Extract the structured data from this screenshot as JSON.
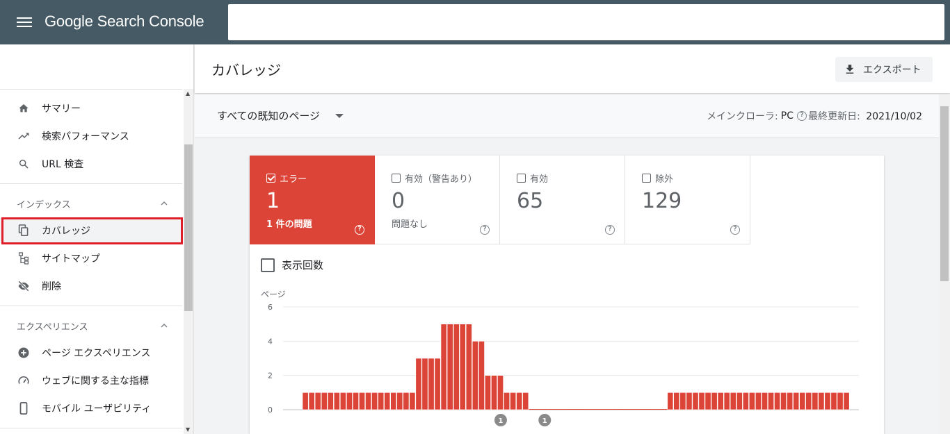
{
  "app": {
    "brand": "Google Search Console",
    "search_value": ""
  },
  "sidebar": {
    "items_top": [
      {
        "label": "サマリー",
        "icon": "home-icon"
      },
      {
        "label": "検索パフォーマンス",
        "icon": "trending-up-icon"
      },
      {
        "label": "URL 検査",
        "icon": "search-icon"
      }
    ],
    "index_section": "インデックス",
    "index_items": [
      {
        "label": "カバレッジ",
        "icon": "file-copy-icon"
      },
      {
        "label": "サイトマップ",
        "icon": "sitemap-icon"
      },
      {
        "label": "削除",
        "icon": "visibility-off-icon"
      }
    ],
    "experience_section": "エクスペリエンス",
    "experience_items": [
      {
        "label": "ページ エクスペリエンス",
        "icon": "add-circle-icon"
      },
      {
        "label": "ウェブに関する主な指標",
        "icon": "speed-icon"
      },
      {
        "label": "モバイル ユーザビリティ",
        "icon": "smartphone-icon"
      }
    ]
  },
  "header": {
    "title": "カバレッジ",
    "export_label": "エクスポート"
  },
  "filter": {
    "selected": "すべての既知のページ",
    "crawler_label": "メインクローラ:",
    "crawler_value": "PC",
    "updated_label": "最終更新日:",
    "updated_value": "2021/10/02"
  },
  "tiles": [
    {
      "label": "エラー",
      "value": "1",
      "sub": "1 件の問題",
      "checked": true
    },
    {
      "label": "有効（警告あり）",
      "value": "0",
      "sub": "問題なし",
      "checked": false
    },
    {
      "label": "有効",
      "value": "65",
      "sub": "",
      "checked": false
    },
    {
      "label": "除外",
      "value": "129",
      "sub": "",
      "checked": false
    }
  ],
  "impressions_label": "表示回数",
  "colors": {
    "topbar": "#455a64",
    "error": "#db4437",
    "highlight": "#e01e28"
  },
  "chart_data": {
    "type": "bar",
    "ylabel": "ページ",
    "ylim": [
      0,
      6
    ],
    "yticks": [
      0,
      2,
      4,
      6
    ],
    "grid": true,
    "values": [
      1,
      1,
      1,
      1,
      1,
      1,
      1,
      1,
      1,
      1,
      1,
      1,
      1,
      1,
      1,
      1,
      1,
      1,
      3,
      3,
      3,
      3,
      5,
      5,
      5,
      5,
      5,
      4,
      4,
      2,
      2,
      2,
      1,
      1,
      1,
      1,
      0,
      0,
      0,
      0,
      0,
      0,
      0,
      0,
      0,
      0,
      0,
      0,
      0,
      0,
      0,
      0,
      0,
      0,
      0,
      0,
      0,
      0,
      1,
      1,
      1,
      1,
      1,
      1,
      1,
      1,
      1,
      1,
      1,
      1,
      1,
      1,
      1,
      1,
      1,
      1,
      1,
      1,
      1,
      1,
      1,
      1,
      1,
      1,
      1,
      1,
      1
    ],
    "annotations": [
      {
        "index": 31,
        "label": "1"
      },
      {
        "index": 38,
        "label": "1"
      }
    ]
  }
}
